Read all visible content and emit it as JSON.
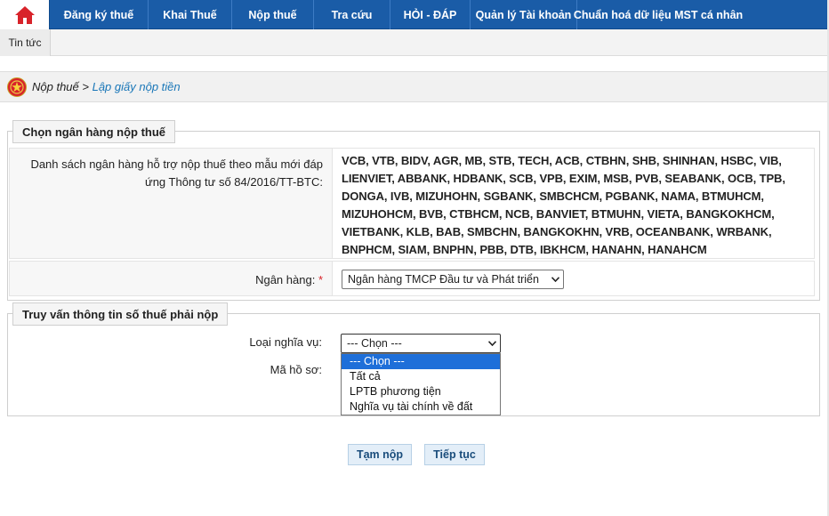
{
  "nav": {
    "items": [
      {
        "label": "Đăng ký thuế"
      },
      {
        "label": "Khai Thuế"
      },
      {
        "label": "Nộp thuế"
      },
      {
        "label": "Tra cứu"
      },
      {
        "label": "HỎI - ĐÁP"
      },
      {
        "label": "Quản lý Tài khoản"
      },
      {
        "label": "Chuẩn hoá dữ liệu MST cá nhân"
      }
    ],
    "home_icon": "home-icon"
  },
  "subnav": {
    "item": "Tin tức"
  },
  "breadcrumb": {
    "parent": "Nộp thuế",
    "sep": " > ",
    "current": "Lập giấy nộp tiền"
  },
  "bank_section": {
    "legend": "Chọn ngân hàng nộp thuế",
    "list_label": "Danh sách ngân hàng hỗ trợ nộp thuế theo mẫu mới đáp ứng Thông tư số 84/2016/TT-BTC:",
    "bank_list": "VCB, VTB, BIDV, AGR, MB, STB, TECH, ACB, CTBHN, SHB, SHINHAN, HSBC, VIB, LIENVIET, ABBANK, HDBANK, SCB, VPB, EXIM, MSB, PVB, SEABANK, OCB, TPB, DONGA, IVB, MIZUHOHN, SGBANK, SMBCHCM, PGBANK, NAMA, BTMUHCM, MIZUHOHCM, BVB, CTBHCM, NCB, BANVIET, BTMUHN, VIETA, BANGKOKHCM, VIETBANK, KLB, BAB, SMBCHN, BANGKOKHN, VRB, OCEANBANK, WRBANK, BNPHCM, SIAM, BNPHN, PBB, DTB, IBKHCM, HANAHN, HANAHCM",
    "bank_label": "Ngân hàng:",
    "required_mark": "*",
    "bank_selected": "Ngân hàng TMCP Đầu tư và Phát triển"
  },
  "query_section": {
    "legend": "Truy vấn thông tin số thuế phải nộp",
    "obligation_label": "Loại nghĩa vụ:",
    "obligation_selected": "--- Chọn ---",
    "dossier_label": "Mã hồ sơ:",
    "options": [
      "--- Chọn ---",
      "Tất cả",
      "LPTB phương tiện",
      "Nghĩa vụ tài chính về đất"
    ]
  },
  "actions": {
    "save": "Tạm nộp",
    "continue": "Tiếp tục"
  },
  "colors": {
    "nav_bg": "#1a5ca7",
    "link": "#1a77b8",
    "highlight": "#1e6fd9"
  }
}
